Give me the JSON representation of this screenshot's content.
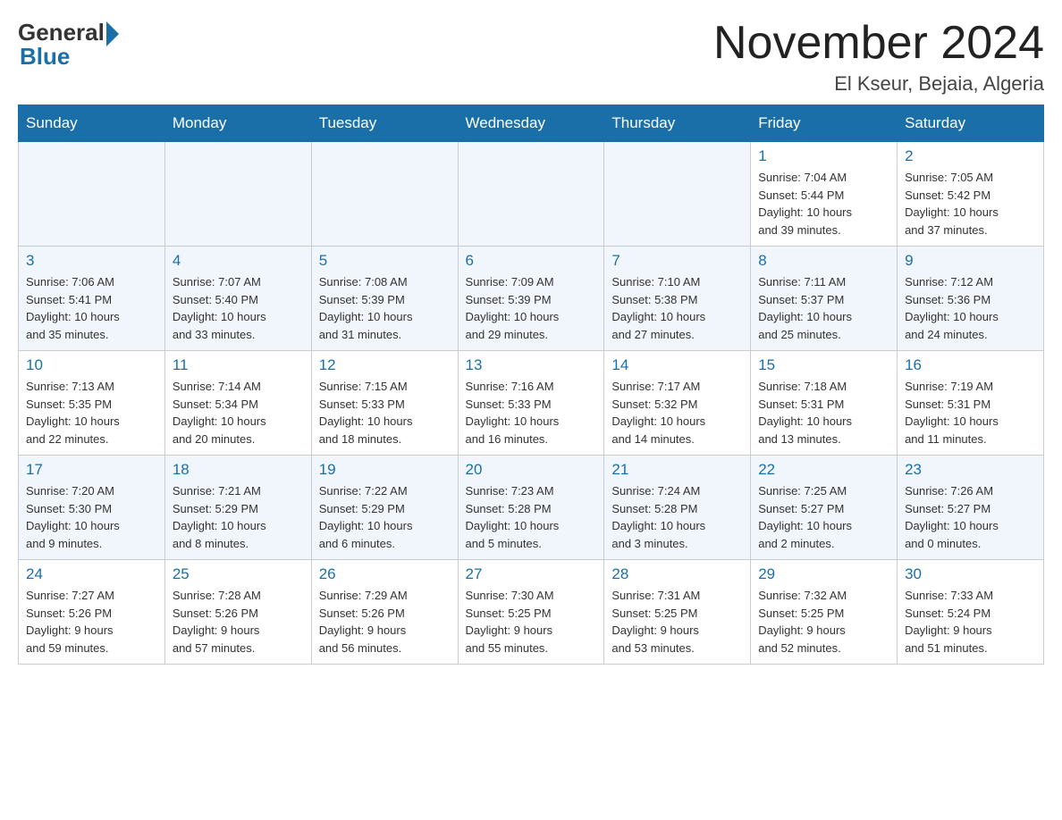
{
  "header": {
    "logo_general": "General",
    "logo_blue": "Blue",
    "title": "November 2024",
    "location": "El Kseur, Bejaia, Algeria"
  },
  "weekdays": [
    "Sunday",
    "Monday",
    "Tuesday",
    "Wednesday",
    "Thursday",
    "Friday",
    "Saturday"
  ],
  "weeks": [
    [
      {
        "day": "",
        "info": ""
      },
      {
        "day": "",
        "info": ""
      },
      {
        "day": "",
        "info": ""
      },
      {
        "day": "",
        "info": ""
      },
      {
        "day": "",
        "info": ""
      },
      {
        "day": "1",
        "info": "Sunrise: 7:04 AM\nSunset: 5:44 PM\nDaylight: 10 hours\nand 39 minutes."
      },
      {
        "day": "2",
        "info": "Sunrise: 7:05 AM\nSunset: 5:42 PM\nDaylight: 10 hours\nand 37 minutes."
      }
    ],
    [
      {
        "day": "3",
        "info": "Sunrise: 7:06 AM\nSunset: 5:41 PM\nDaylight: 10 hours\nand 35 minutes."
      },
      {
        "day": "4",
        "info": "Sunrise: 7:07 AM\nSunset: 5:40 PM\nDaylight: 10 hours\nand 33 minutes."
      },
      {
        "day": "5",
        "info": "Sunrise: 7:08 AM\nSunset: 5:39 PM\nDaylight: 10 hours\nand 31 minutes."
      },
      {
        "day": "6",
        "info": "Sunrise: 7:09 AM\nSunset: 5:39 PM\nDaylight: 10 hours\nand 29 minutes."
      },
      {
        "day": "7",
        "info": "Sunrise: 7:10 AM\nSunset: 5:38 PM\nDaylight: 10 hours\nand 27 minutes."
      },
      {
        "day": "8",
        "info": "Sunrise: 7:11 AM\nSunset: 5:37 PM\nDaylight: 10 hours\nand 25 minutes."
      },
      {
        "day": "9",
        "info": "Sunrise: 7:12 AM\nSunset: 5:36 PM\nDaylight: 10 hours\nand 24 minutes."
      }
    ],
    [
      {
        "day": "10",
        "info": "Sunrise: 7:13 AM\nSunset: 5:35 PM\nDaylight: 10 hours\nand 22 minutes."
      },
      {
        "day": "11",
        "info": "Sunrise: 7:14 AM\nSunset: 5:34 PM\nDaylight: 10 hours\nand 20 minutes."
      },
      {
        "day": "12",
        "info": "Sunrise: 7:15 AM\nSunset: 5:33 PM\nDaylight: 10 hours\nand 18 minutes."
      },
      {
        "day": "13",
        "info": "Sunrise: 7:16 AM\nSunset: 5:33 PM\nDaylight: 10 hours\nand 16 minutes."
      },
      {
        "day": "14",
        "info": "Sunrise: 7:17 AM\nSunset: 5:32 PM\nDaylight: 10 hours\nand 14 minutes."
      },
      {
        "day": "15",
        "info": "Sunrise: 7:18 AM\nSunset: 5:31 PM\nDaylight: 10 hours\nand 13 minutes."
      },
      {
        "day": "16",
        "info": "Sunrise: 7:19 AM\nSunset: 5:31 PM\nDaylight: 10 hours\nand 11 minutes."
      }
    ],
    [
      {
        "day": "17",
        "info": "Sunrise: 7:20 AM\nSunset: 5:30 PM\nDaylight: 10 hours\nand 9 minutes."
      },
      {
        "day": "18",
        "info": "Sunrise: 7:21 AM\nSunset: 5:29 PM\nDaylight: 10 hours\nand 8 minutes."
      },
      {
        "day": "19",
        "info": "Sunrise: 7:22 AM\nSunset: 5:29 PM\nDaylight: 10 hours\nand 6 minutes."
      },
      {
        "day": "20",
        "info": "Sunrise: 7:23 AM\nSunset: 5:28 PM\nDaylight: 10 hours\nand 5 minutes."
      },
      {
        "day": "21",
        "info": "Sunrise: 7:24 AM\nSunset: 5:28 PM\nDaylight: 10 hours\nand 3 minutes."
      },
      {
        "day": "22",
        "info": "Sunrise: 7:25 AM\nSunset: 5:27 PM\nDaylight: 10 hours\nand 2 minutes."
      },
      {
        "day": "23",
        "info": "Sunrise: 7:26 AM\nSunset: 5:27 PM\nDaylight: 10 hours\nand 0 minutes."
      }
    ],
    [
      {
        "day": "24",
        "info": "Sunrise: 7:27 AM\nSunset: 5:26 PM\nDaylight: 9 hours\nand 59 minutes."
      },
      {
        "day": "25",
        "info": "Sunrise: 7:28 AM\nSunset: 5:26 PM\nDaylight: 9 hours\nand 57 minutes."
      },
      {
        "day": "26",
        "info": "Sunrise: 7:29 AM\nSunset: 5:26 PM\nDaylight: 9 hours\nand 56 minutes."
      },
      {
        "day": "27",
        "info": "Sunrise: 7:30 AM\nSunset: 5:25 PM\nDaylight: 9 hours\nand 55 minutes."
      },
      {
        "day": "28",
        "info": "Sunrise: 7:31 AM\nSunset: 5:25 PM\nDaylight: 9 hours\nand 53 minutes."
      },
      {
        "day": "29",
        "info": "Sunrise: 7:32 AM\nSunset: 5:25 PM\nDaylight: 9 hours\nand 52 minutes."
      },
      {
        "day": "30",
        "info": "Sunrise: 7:33 AM\nSunset: 5:24 PM\nDaylight: 9 hours\nand 51 minutes."
      }
    ]
  ]
}
